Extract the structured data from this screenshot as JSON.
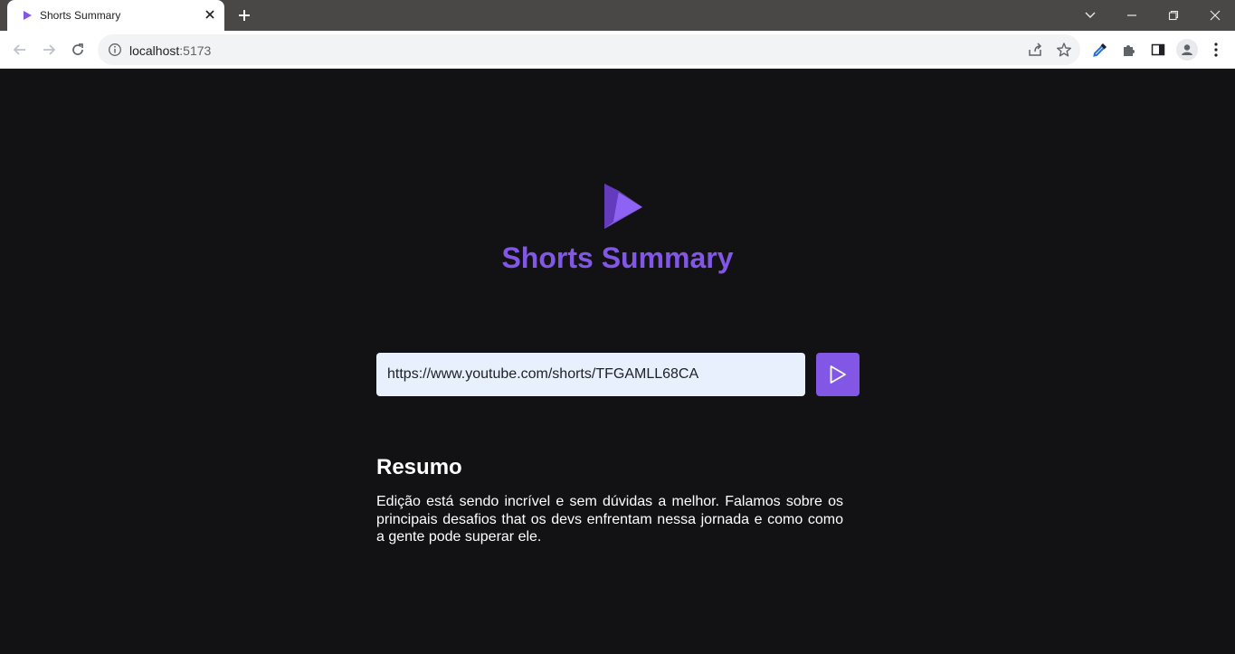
{
  "browser": {
    "tab_title": "Shorts Summary",
    "url_host": "localhost",
    "url_port": ":5173",
    "icons": [
      "favicon-play-icon",
      "tab-close-icon",
      "new-tab-icon",
      "tab-search-icon",
      "minimize-icon",
      "restore-icon",
      "close-window-icon",
      "back-icon",
      "forward-icon",
      "reload-icon",
      "site-info-icon",
      "share-icon",
      "bookmark-star-icon",
      "eyedropper-icon",
      "extensions-icon",
      "side-panel-icon",
      "profile-icon",
      "menu-icon"
    ]
  },
  "app": {
    "title": "Shorts Summary",
    "accent_color": "#8257e5",
    "background_color": "#121214",
    "url_input_value": "https://www.youtube.com/shorts/TFGAMLL68CA",
    "summary_heading": "Resumo",
    "summary_text": "Edição está sendo incrível e sem dúvidas a melhor. Falamos sobre os principais desafios that os devs enfrentam nessa jornada e como como a gente pode superar ele."
  }
}
